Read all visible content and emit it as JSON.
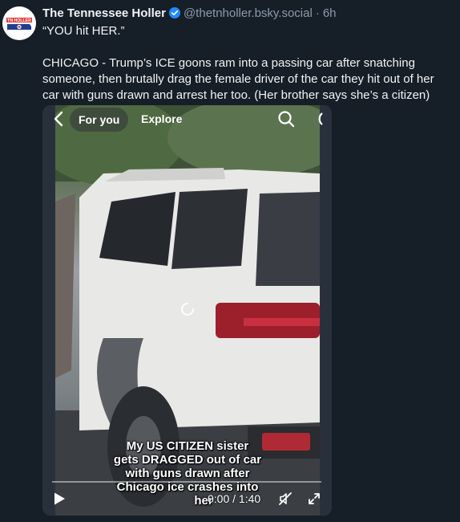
{
  "post": {
    "author": {
      "avatar_text": "TN HOLLER",
      "display_name": "The Tennessee Holler",
      "handle": "@thetnholler.bsky.social",
      "separator": "·",
      "time": "6h",
      "verified": true
    },
    "quote_line": "“YOU hit HER.”",
    "body": "CHICAGO - Trump’s ICE goons ram into a passing car after snatching someone, then brutally drag the female driver of the car they hit out of her car with guns drawn and arrest her too. (Her brother says she’s a citizen)"
  },
  "video": {
    "tabs": {
      "for_you": "For you",
      "explore": "Explore"
    },
    "caption": [
      "My US CITIZEN sister",
      "gets DRAGGED out of car",
      "with guns drawn  after",
      "Chicago ice crashes into"
    ],
    "caption_tail": "her",
    "time": "0:00 / 1:40",
    "progress": 0.0
  },
  "icons": {
    "verified": "verified-check-icon",
    "back": "chevron-left-icon",
    "search": "search-icon",
    "play": "play-icon",
    "mute": "muted-speaker-icon",
    "fullscreen": "fullscreen-icon",
    "loading": "loading-spinner-icon"
  },
  "colors": {
    "background": "#161e27",
    "muted_text": "#8d9bab",
    "verified": "#208bfe"
  }
}
